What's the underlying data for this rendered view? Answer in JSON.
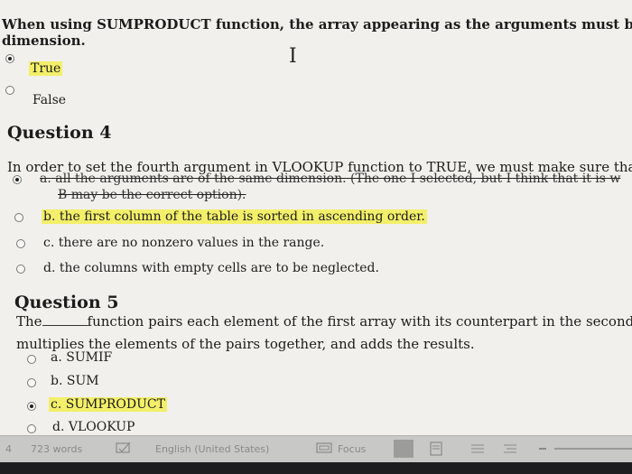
{
  "question3": {
    "prompt_line1": "When using SUMPRODUCT function, the array appearing as the arguments must be of the sa",
    "prompt_line2": "dimension.",
    "options": [
      {
        "label": "True",
        "selected": true,
        "highlighted": true
      },
      {
        "label": "False",
        "selected": false,
        "highlighted": false
      }
    ]
  },
  "question4": {
    "heading": "Question 4",
    "prompt": "In order to set the fourth argument in VLOOKUP function to TRUE, we must make sure that",
    "options": [
      {
        "letter": "a.",
        "label": "all the arguments are of the same dimension. (The one I selected, but I think that it is w",
        "label_line2": "B may be the correct option).",
        "selected": true,
        "struck": true
      },
      {
        "letter": "b.",
        "label": "the first column of the table is sorted in ascending order.",
        "selected": false,
        "highlighted": true
      },
      {
        "letter": "c.",
        "label": "there are no nonzero values in the range.",
        "selected": false
      },
      {
        "letter": "d.",
        "label": "the columns with empty cells are to be neglected.",
        "selected": false
      }
    ]
  },
  "question5": {
    "heading": "Question 5",
    "prompt_start": "The",
    "prompt_rest": "function pairs each element of the first array with its counterpart in the second arra",
    "prompt_line2": "multiplies the elements of the pairs together, and adds the results.",
    "options": [
      {
        "letter": "a.",
        "label": "SUMIF",
        "selected": false
      },
      {
        "letter": "b.",
        "label": "SUM",
        "selected": false
      },
      {
        "letter": "c.",
        "label": "SUMPRODUCT",
        "selected": true,
        "highlighted": true
      },
      {
        "letter": "d.",
        "label": "VLOOKUP",
        "selected": false
      }
    ]
  },
  "status_bar": {
    "page_indicator": "4",
    "word_count": "723 words",
    "language": "English (United States)",
    "focus_label": "Focus"
  },
  "colors": {
    "highlight": "#f3ef6a",
    "page_background": "#f1f0ec",
    "status_bar_background": "#c8c8c6"
  }
}
